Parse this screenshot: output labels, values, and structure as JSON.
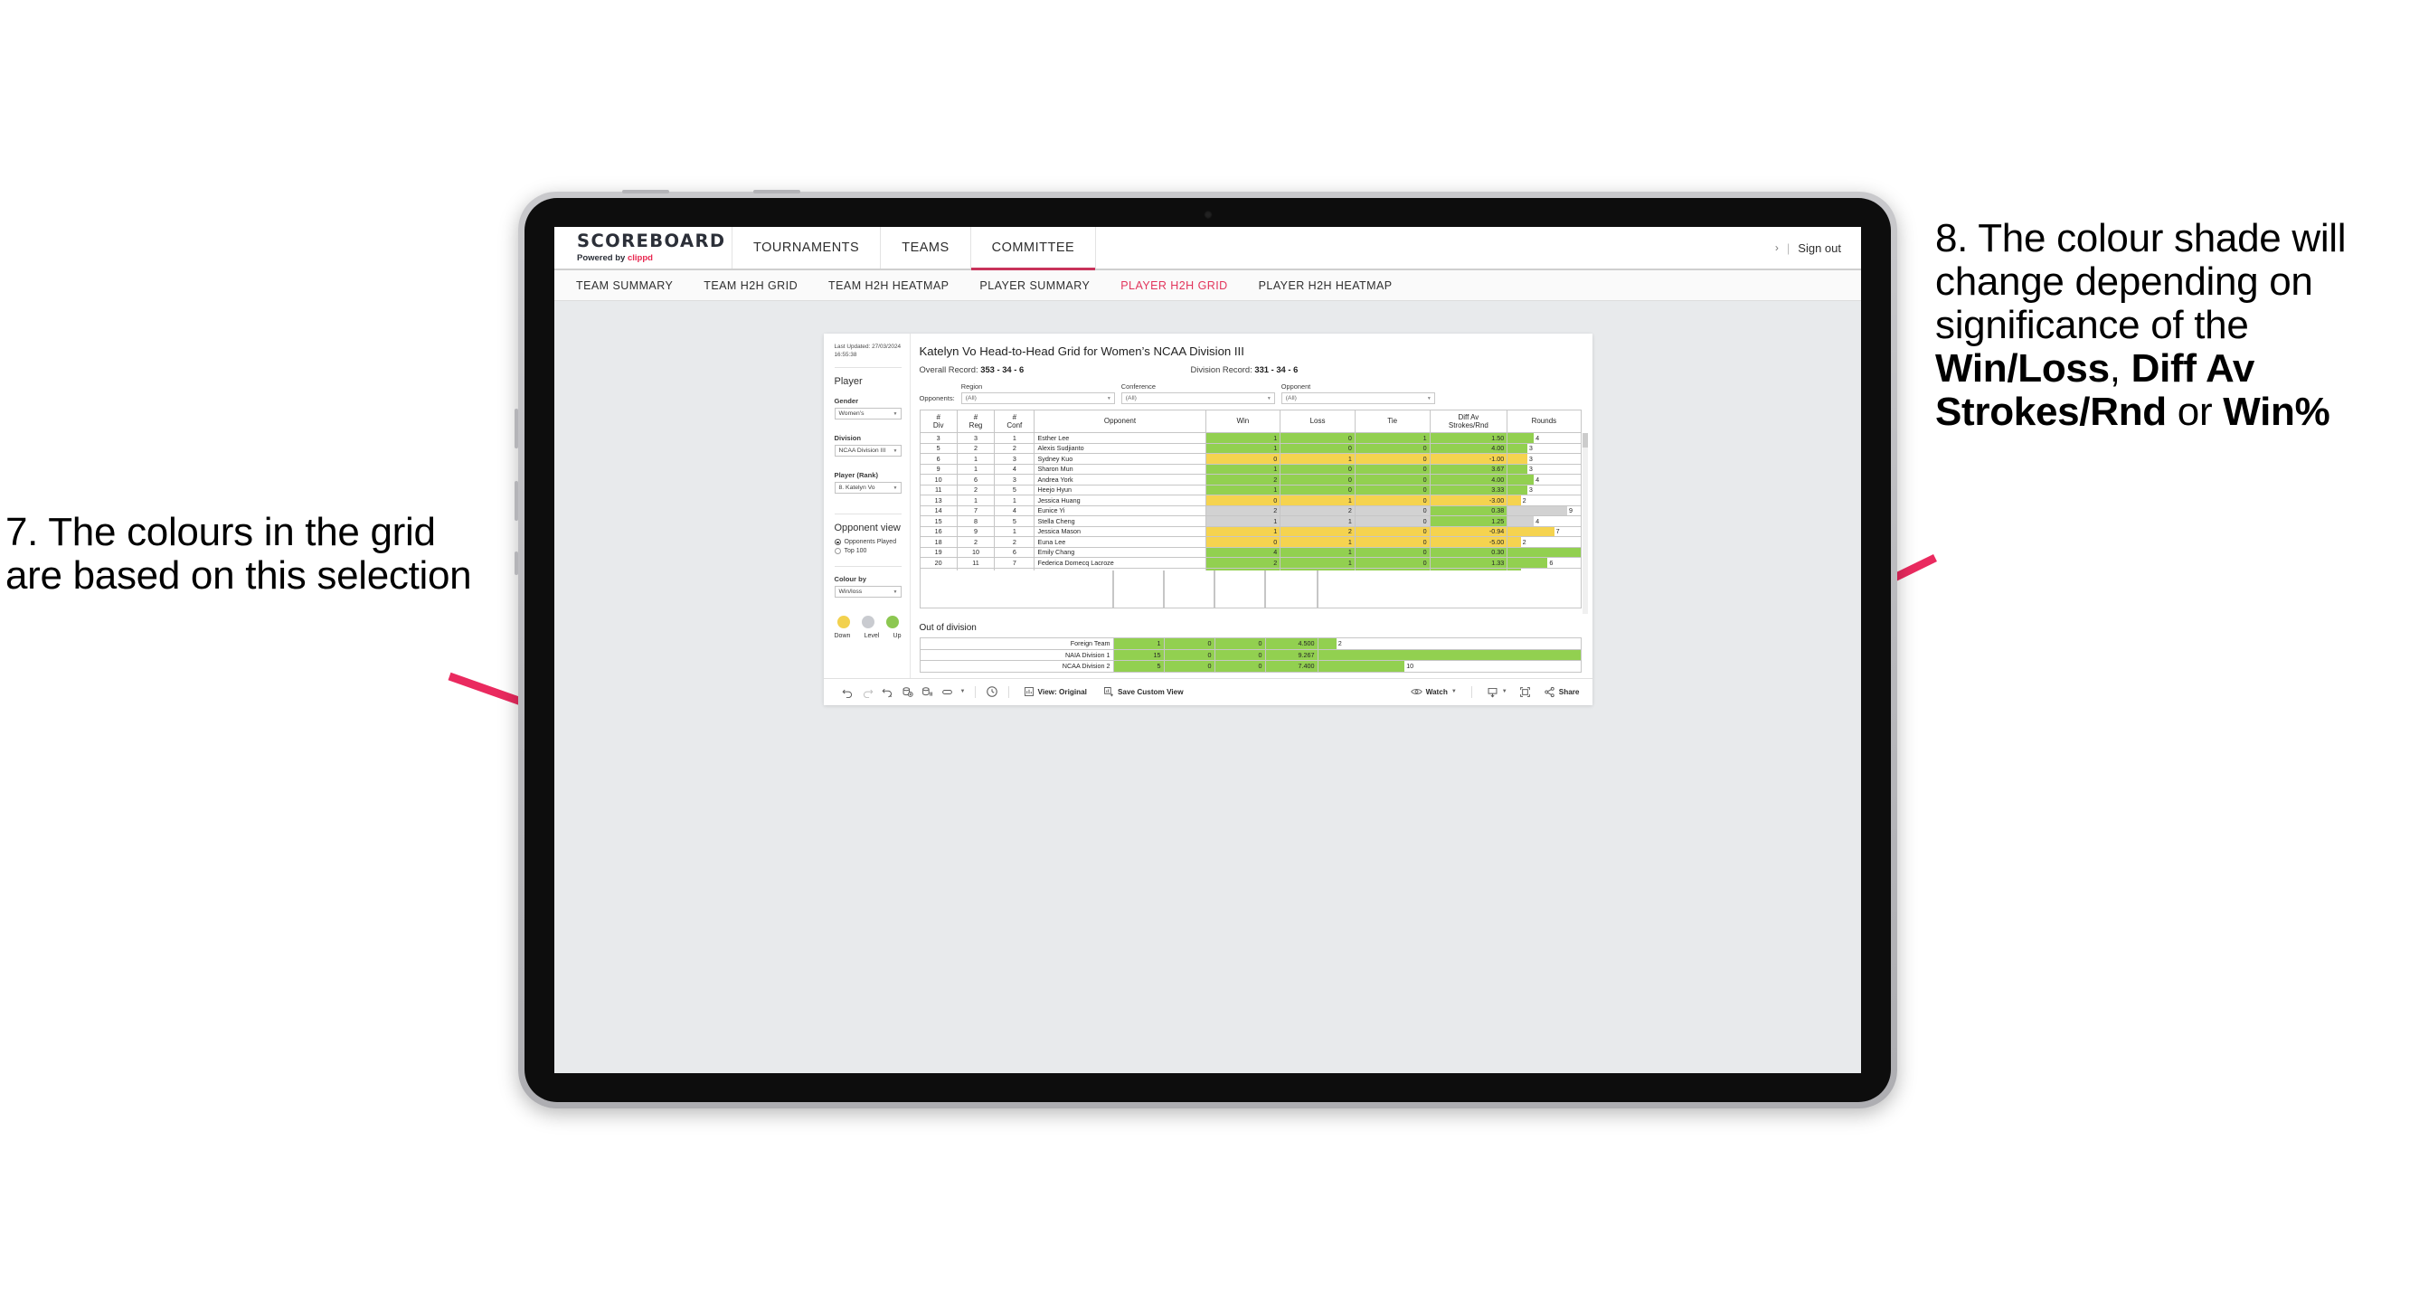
{
  "annotations": {
    "left": {
      "number": "7.",
      "text": "7. The colours in the grid are based on this selection"
    },
    "right": {
      "line1": "8. The colour shade will change depending on significance of the ",
      "bold1": "Win/Loss",
      "mid1": ", ",
      "bold2": "Diff Av Strokes/Rnd",
      "mid2": " or ",
      "bold3": "Win%"
    },
    "arrow_color": "#ea2a5f"
  },
  "topnav": {
    "brand_title": "SCOREBOARD",
    "brand_sub_prefix": "Powered by ",
    "brand_sub_brand": "clippd",
    "tabs": [
      {
        "label": "TOURNAMENTS",
        "active": false
      },
      {
        "label": "TEAMS",
        "active": false
      },
      {
        "label": "COMMITTEE",
        "active": true
      }
    ],
    "chevron": "›",
    "pipe": "|",
    "signout": "Sign out"
  },
  "subnav": {
    "items": [
      {
        "label": "TEAM SUMMARY",
        "active": false
      },
      {
        "label": "TEAM H2H GRID",
        "active": false
      },
      {
        "label": "TEAM H2H HEATMAP",
        "active": false
      },
      {
        "label": "PLAYER SUMMARY",
        "active": false
      },
      {
        "label": "PLAYER H2H GRID",
        "active": true
      },
      {
        "label": "PLAYER H2H HEATMAP",
        "active": false
      }
    ],
    "active_color": "#e2355c"
  },
  "sidebar": {
    "last_updated": "Last Updated: 27/03/2024 16:55:38",
    "heading": "Player",
    "gender": {
      "label": "Gender",
      "value": "Women’s"
    },
    "division": {
      "label": "Division",
      "value": "NCAA Division III"
    },
    "player_rank": {
      "label": "Player (Rank)",
      "value": "8. Katelyn Vo"
    },
    "opponent_view": {
      "heading": "Opponent view",
      "options": [
        {
          "label": "Opponents Played",
          "selected": true
        },
        {
          "label": "Top 100",
          "selected": false
        }
      ]
    },
    "colour_by": {
      "label": "Colour by",
      "value": "Win/loss"
    },
    "legend": {
      "items": [
        {
          "label": "Down",
          "color": "#f2d14e"
        },
        {
          "label": "Level",
          "color": "#c9cbd0"
        },
        {
          "label": "Up",
          "color": "#8cc751"
        }
      ]
    }
  },
  "main": {
    "title": "Katelyn Vo Head-to-Head Grid for Women’s NCAA Division III",
    "overall_record_label": "Overall Record: ",
    "overall_record_value": "353 -  34 - 6",
    "division_record_label": "Division Record: ",
    "division_record_value": "331 -  34 - 6",
    "opponents_label": "Opponents:",
    "filters": [
      {
        "label": "Region",
        "value": "(All)"
      },
      {
        "label": "Conference",
        "value": "(All)"
      },
      {
        "label": "Opponent",
        "value": "(All)"
      }
    ],
    "table": {
      "headers": [
        "#\nDiv",
        "#\nReg",
        "#\nConf",
        "Opponent",
        "Win",
        "Loss",
        "Tie",
        "Diff Av\nStrokes/Rnd",
        "Rounds"
      ],
      "header_div_l1": "#",
      "header_div_l2": "Div",
      "header_reg_l1": "#",
      "header_reg_l2": "Reg",
      "header_conf_l1": "#",
      "header_conf_l2": "Conf",
      "header_opponent": "Opponent",
      "header_win": "Win",
      "header_loss": "Loss",
      "header_tie": "Tie",
      "header_diff_l1": "Diff Av",
      "header_diff_l2": "Strokes/Rnd",
      "header_rounds": "Rounds",
      "rows": [
        {
          "div": "3",
          "reg": "3",
          "conf": "1",
          "opponent": "Esther Lee",
          "win": "1",
          "loss": "0",
          "tie": "1",
          "diff": "1.50",
          "rounds": "4",
          "rounds_pct": 36,
          "shade": "green"
        },
        {
          "div": "5",
          "reg": "2",
          "conf": "2",
          "opponent": "Alexis Sudjianto",
          "win": "1",
          "loss": "0",
          "tie": "0",
          "diff": "4.00",
          "rounds": "3",
          "rounds_pct": 27,
          "shade": "green"
        },
        {
          "div": "6",
          "reg": "1",
          "conf": "3",
          "opponent": "Sydney Kuo",
          "win": "0",
          "loss": "1",
          "tie": "0",
          "diff": "-1.00",
          "rounds": "3",
          "rounds_pct": 27,
          "shade": "yellow"
        },
        {
          "div": "9",
          "reg": "1",
          "conf": "4",
          "opponent": "Sharon Mun",
          "win": "1",
          "loss": "0",
          "tie": "0",
          "diff": "3.67",
          "rounds": "3",
          "rounds_pct": 27,
          "shade": "green"
        },
        {
          "div": "10",
          "reg": "6",
          "conf": "3",
          "opponent": "Andrea York",
          "win": "2",
          "loss": "0",
          "tie": "0",
          "diff": "4.00",
          "rounds": "4",
          "rounds_pct": 36,
          "shade": "green"
        },
        {
          "div": "11",
          "reg": "2",
          "conf": "5",
          "opponent": "Heejo Hyun",
          "win": "1",
          "loss": "0",
          "tie": "0",
          "diff": "3.33",
          "rounds": "3",
          "rounds_pct": 27,
          "shade": "green"
        },
        {
          "div": "13",
          "reg": "1",
          "conf": "1",
          "opponent": "Jessica Huang",
          "win": "0",
          "loss": "1",
          "tie": "0",
          "diff": "-3.00",
          "rounds": "2",
          "rounds_pct": 18,
          "shade": "yellow"
        },
        {
          "div": "14",
          "reg": "7",
          "conf": "4",
          "opponent": "Eunice Yi",
          "win": "2",
          "loss": "2",
          "tie": "0",
          "diff": "0.38",
          "rounds": "9",
          "rounds_pct": 82,
          "shade": "grey",
          "diff_shade": "green"
        },
        {
          "div": "15",
          "reg": "8",
          "conf": "5",
          "opponent": "Stella Cheng",
          "win": "1",
          "loss": "1",
          "tie": "0",
          "diff": "1.25",
          "rounds": "4",
          "rounds_pct": 36,
          "shade": "grey",
          "diff_shade": "green"
        },
        {
          "div": "16",
          "reg": "9",
          "conf": "1",
          "opponent": "Jessica Mason",
          "win": "1",
          "loss": "2",
          "tie": "0",
          "diff": "-0.94",
          "rounds": "7",
          "rounds_pct": 64,
          "shade": "yellow"
        },
        {
          "div": "18",
          "reg": "2",
          "conf": "2",
          "opponent": "Euna Lee",
          "win": "0",
          "loss": "1",
          "tie": "0",
          "diff": "-5.00",
          "rounds": "2",
          "rounds_pct": 18,
          "shade": "yellow"
        },
        {
          "div": "19",
          "reg": "10",
          "conf": "6",
          "opponent": "Emily Chang",
          "win": "4",
          "loss": "1",
          "tie": "0",
          "diff": "0.30",
          "rounds": "11",
          "rounds_pct": 100,
          "shade": "green"
        },
        {
          "div": "20",
          "reg": "11",
          "conf": "7",
          "opponent": "Federica Domecq Lacroze",
          "win": "2",
          "loss": "1",
          "tie": "0",
          "diff": "1.33",
          "rounds": "6",
          "rounds_pct": 55,
          "shade": "green"
        }
      ]
    },
    "out_of_division": {
      "title": "Out of division",
      "rows": [
        {
          "name": "Foreign Team",
          "win": "1",
          "loss": "0",
          "tie": "0",
          "diff": "4.500",
          "rounds": "2",
          "rounds_pct": 7,
          "shade": "green"
        },
        {
          "name": "NAIA Division 1",
          "win": "15",
          "loss": "0",
          "tie": "0",
          "diff": "9.267",
          "rounds": "30",
          "rounds_pct": 100,
          "shade": "green"
        },
        {
          "name": "NCAA Division 2",
          "win": "5",
          "loss": "0",
          "tie": "0",
          "diff": "7.400",
          "rounds": "10",
          "rounds_pct": 33,
          "shade": "green"
        }
      ]
    }
  },
  "toolbar": {
    "undo": "undo-icon",
    "redo": "redo-icon",
    "revert": "revert-icon",
    "refresh": "refresh-data-icon",
    "pause": "pause-updates-icon",
    "subscribe": "alerts-icon",
    "view_label": "View: Original",
    "save_custom_view": "Save Custom View",
    "watch": "Watch",
    "share": "Share",
    "download": "download-icon",
    "fullscreen": "fullscreen-icon"
  }
}
